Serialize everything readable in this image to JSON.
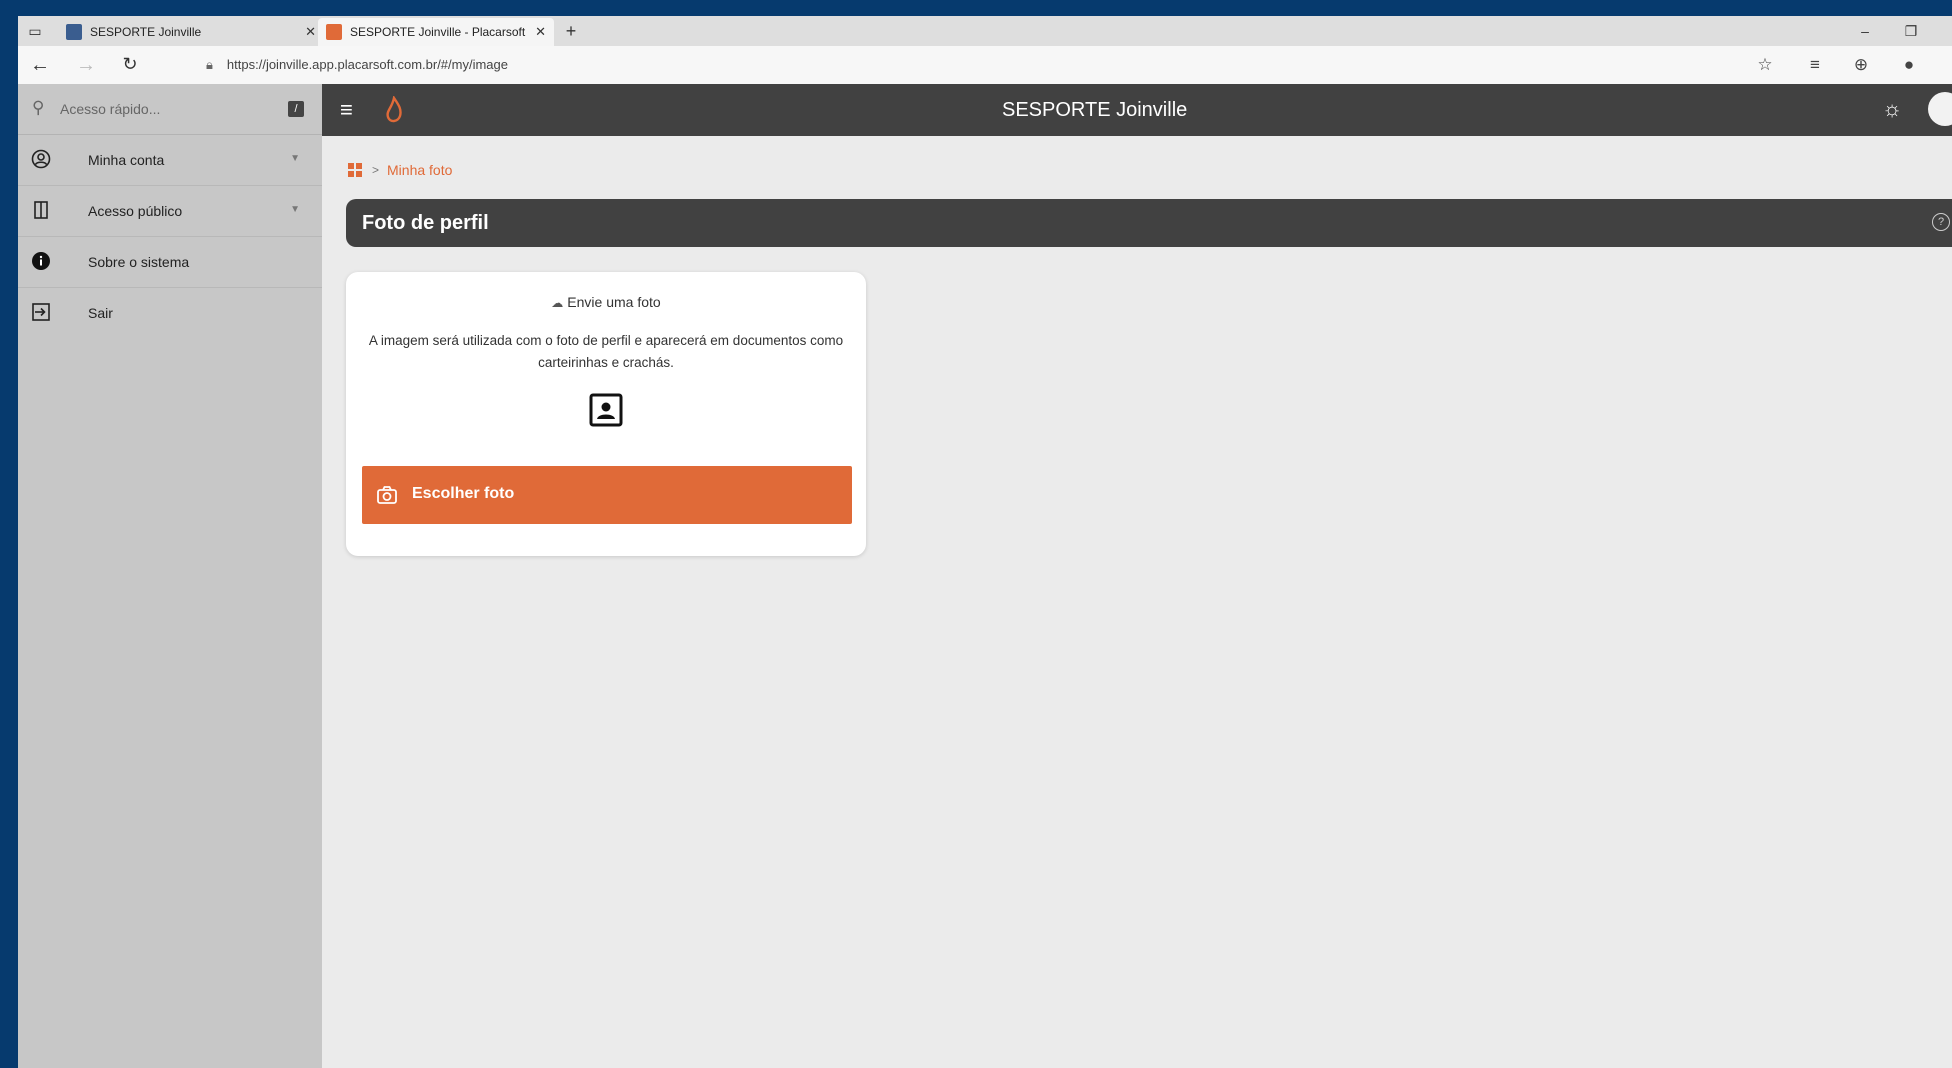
{
  "browser": {
    "tabs": [
      {
        "title": "SESPORTE Joinville",
        "active": false
      },
      {
        "title": "SESPORTE Joinville - Placarsoft",
        "active": true
      }
    ],
    "url": "https://joinville.app.placarsoft.com.br/#/my/image"
  },
  "sidebar": {
    "search_placeholder": "Acesso rápido...",
    "shortcut_key": "/",
    "items": [
      {
        "label": "Minha conta",
        "icon": "account-circle-icon",
        "expandable": true
      },
      {
        "label": "Acesso público",
        "icon": "door-icon",
        "expandable": true
      },
      {
        "label": "Sobre o sistema",
        "icon": "info-icon",
        "expandable": false
      },
      {
        "label": "Sair",
        "icon": "logout-icon",
        "expandable": false
      }
    ]
  },
  "header": {
    "title": "SESPORTE Joinville"
  },
  "breadcrumb": {
    "current": "Minha foto",
    "separator": ">"
  },
  "page": {
    "title": "Foto de perfil"
  },
  "upload_card": {
    "heading": "Envie uma foto",
    "description": "A imagem será utilizada com o foto de perfil e aparecerá em documentos como carteirinhas e crachás.",
    "button_label": "Escolher foto"
  },
  "colors": {
    "accent": "#e06a38",
    "header_bg": "#414141",
    "sidebar_bg": "#c7c7c7",
    "content_bg": "#ebebeb"
  }
}
